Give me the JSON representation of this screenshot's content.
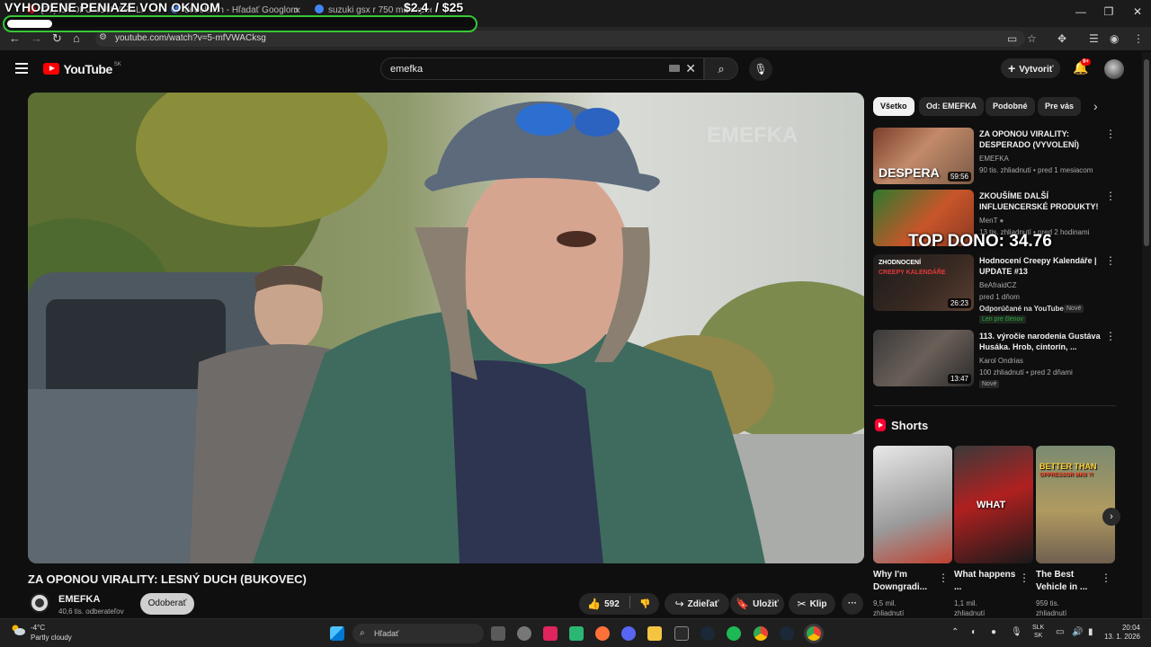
{
  "overlay": {
    "title": "VYHODENE PENIAZE VON OKNOM",
    "raised": "$2.4",
    "goal": "/ $25",
    "progress_fraction": 0.096,
    "top_dono": "TOP DONO: 34.76"
  },
  "browser": {
    "tabs": [
      {
        "label": "(37) ZA OPONOU VIRALI"
      },
      {
        "label": "dedobuch - Hľadať Googlom"
      },
      {
        "label": "suzuki gsx r 750 max speed - "
      }
    ],
    "url": "youtube.com/watch?v=5-mfVWACksg"
  },
  "youtube": {
    "logo_word": "YouTube",
    "region": "SK",
    "search_value": "emefka",
    "create_label": "Vytvoriť",
    "notifications": "9+"
  },
  "video": {
    "title": "ZA OPONOU VIRALITY: LESNÝ DUCH (BUKOVEC)",
    "channel": "EMEFKA",
    "subscribers": "40,6 tis. odberateľov",
    "unsubscribe_label": "Odoberať",
    "likes": "592",
    "share_label": "Zdieľať",
    "save_label": "Uložiť",
    "clip_label": "Klip",
    "watermark": "EMEFKA"
  },
  "chips": [
    "Všetko",
    "Od: EMEFKA",
    "Podobné",
    "Pre vás"
  ],
  "related": [
    {
      "title": "ZA OPONOU VIRALITY: DESPERADO (VYVOLENÍ)",
      "channel": "EMEFKA",
      "meta": "90 tis. zhliadnutí • pred 1 mesiacom",
      "duration": "59:56",
      "thumb_text": "DESPERA"
    },
    {
      "title": "ZKOUŠÍME DALŠÍ INFLUENCERSKÉ PRODUKTY! ...",
      "channel": "MenT",
      "meta": "13 tis. zhliadnutí • pred 2 hodinami",
      "duration": ""
    },
    {
      "title": "Hodnocení Creepy Kalendáře | UPDATE #13",
      "channel": "BeAfraidCZ",
      "meta": "pred 1 dňom",
      "duration": "26:23",
      "recommended": "Odporúčané na YouTube",
      "badge_new": "Nové",
      "member": "Len pre členov",
      "thumb_text": "ZHODNOCENÍ",
      "thumb_text2": "CREEPY KALENDÁŘE"
    },
    {
      "title": "113. výročie narodenia Gustáva Husáka. Hrob, cintorín, ...",
      "channel": "Karol Ondrias",
      "meta": "100 zhliadnutí • pred 2 dňami",
      "duration": "13:47",
      "badge_new": "Nové"
    }
  ],
  "shorts": {
    "header": "Shorts",
    "items": [
      {
        "title": "Why I'm Downgradi...",
        "views": "9,5 mil.",
        "views2": "zhliadnutí"
      },
      {
        "title": "What happens ...",
        "views": "1,1 mil.",
        "views2": "zhliadnutí",
        "thumb_text": "WHAT"
      },
      {
        "title": "The Best Vehicle in ...",
        "views": "959 tis.",
        "views2": "zhliadnutí",
        "thumb_text": "BETTER THAN",
        "thumb_text2": "OPPRESSOR MKII ?!"
      }
    ]
  },
  "taskbar": {
    "temp": "-4°C",
    "weather": "Partly cloudy",
    "search_placeholder": "Hľadať",
    "lang1": "SLK",
    "lang2": "SK",
    "time": "20:04",
    "date": "13. 1. 2026"
  },
  "colors": {
    "progress_border": "#37c837",
    "youtube_red": "#ff0000",
    "bg": "#0f0f0f"
  }
}
